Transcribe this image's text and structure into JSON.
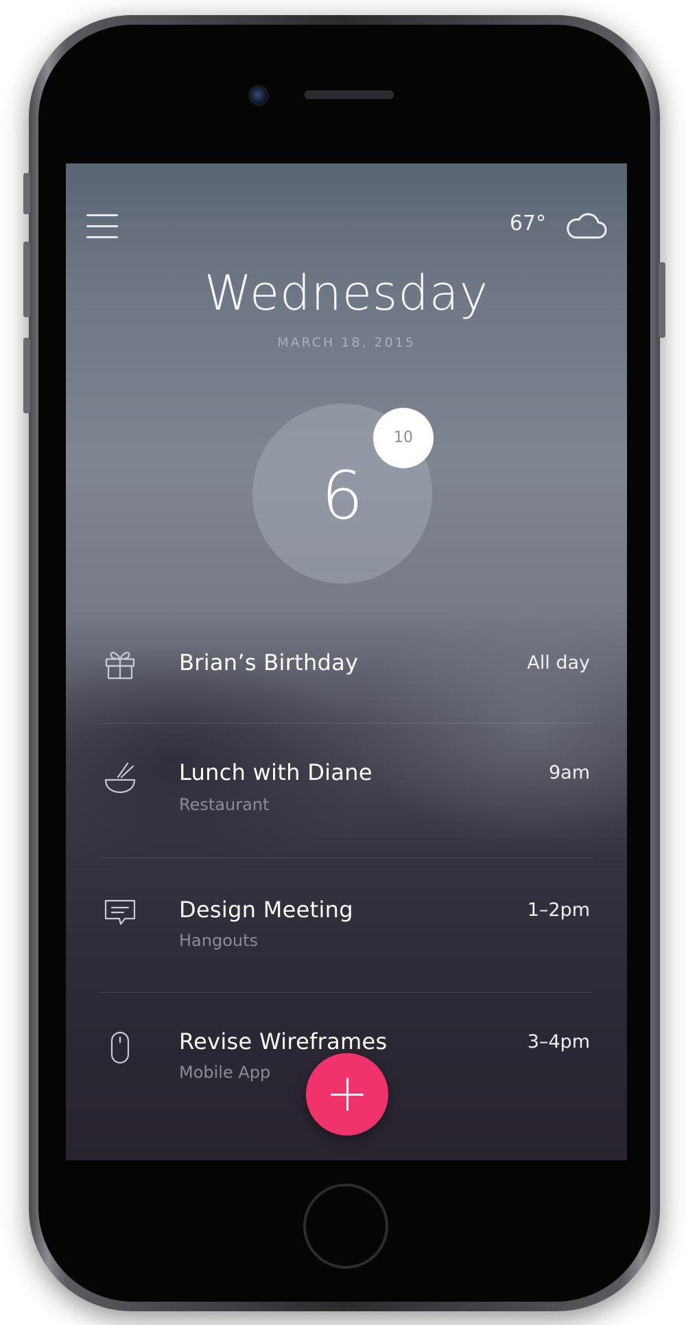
{
  "header": {
    "temperature": "67°",
    "weather_icon": "cloud-icon",
    "menu_icon": "hamburger-menu-icon"
  },
  "day": {
    "title": "Wednesday",
    "date": "MARCH 18, 2015",
    "day_number": "6",
    "badge_count": "10"
  },
  "events": [
    {
      "icon": "gift-icon",
      "title": "Brian’s Birthday",
      "subtitle": "",
      "time": "All day"
    },
    {
      "icon": "bowl-chopsticks-icon",
      "title": "Lunch with Diane",
      "subtitle": "Restaurant",
      "time": "9am"
    },
    {
      "icon": "chat-bubble-icon",
      "title": "Design Meeting",
      "subtitle": "Hangouts",
      "time": "1–2pm"
    },
    {
      "icon": "mouse-icon",
      "title": "Revise Wireframes",
      "subtitle": "Mobile App",
      "time": "3–4pm"
    }
  ],
  "fab": {
    "icon": "plus-icon",
    "color": "#f0336a"
  },
  "colors": {
    "accent": "#f0336a",
    "text_primary": "#ffffff",
    "text_secondary": "#8f8a99"
  }
}
